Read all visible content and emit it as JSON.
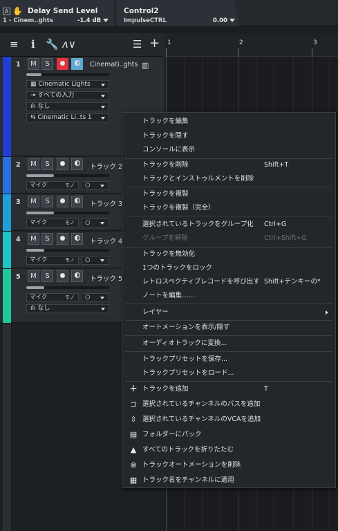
{
  "top_bar": {
    "a_label": "A",
    "param_title": "Delay Send Level",
    "param_source": "1 - Cinem..ghts",
    "param_value": "-1.4 dB",
    "control_title": "Control2",
    "control_source": "ImpulseCTRL",
    "control_value": "0.00"
  },
  "ruler": {
    "marks": [
      "1",
      "2",
      "3"
    ]
  },
  "tracks": [
    {
      "number": "1",
      "name": "Cinemati..ghts",
      "color": "#1f3fd6",
      "mute": "M",
      "solo": "S",
      "record_active": true,
      "monitor_active": true,
      "instrument": "Cinematic Lights",
      "input": "すべての入力",
      "output": "なし",
      "output2": "Cinematic Li..ts 1"
    },
    {
      "number": "2",
      "name": "トラック 2",
      "color": "#2a6ee0",
      "mute": "M",
      "solo": "S",
      "input": "マイク",
      "mono": "モノ"
    },
    {
      "number": "3",
      "name": "トラック 3",
      "color": "#1f9ed8",
      "mute": "M",
      "solo": "S",
      "input": "マイク",
      "mono": "モノ"
    },
    {
      "number": "4",
      "name": "トラック 4",
      "color": "#1fc6c6",
      "mute": "M",
      "solo": "S",
      "input": "マイク",
      "mono": "モノ"
    },
    {
      "number": "5",
      "name": "トラック 5",
      "color": "#20c79a",
      "mute": "M",
      "solo": "S",
      "input": "マイク",
      "mono": "モノ",
      "output": "なし"
    }
  ],
  "context_menu": {
    "items": [
      {
        "label": "トラックを編集"
      },
      {
        "label": "トラックを隠す"
      },
      {
        "label": "コンソールに表示"
      },
      {
        "label": "トラックを削除",
        "shortcut": "Shift+T"
      },
      {
        "label": "トラックとインストゥルメントを削除"
      },
      {
        "label": "トラックを複製"
      },
      {
        "label": "トラックを複製（完全）"
      },
      {
        "label": "選択されているトラックをグループ化",
        "shortcut": "Ctrl+G"
      },
      {
        "label": "グループを解除",
        "shortcut": "Ctrl+Shift+G",
        "disabled": true
      },
      {
        "label": "トラックを無効化"
      },
      {
        "label": "1つのトラックをロック"
      },
      {
        "label": "レトロスペクティブレコードを呼び出す",
        "shortcut": "Shift+テンキーの*"
      },
      {
        "label": "ノートを編集……"
      },
      {
        "label": "レイヤー"
      },
      {
        "label": "オートメーションを表示/隠す"
      },
      {
        "label": "オーディオトラックに変換..."
      },
      {
        "label": "トラックプリセットを保存..."
      },
      {
        "label": "トラックプリセットをロード..."
      },
      {
        "label": "トラックを追加",
        "shortcut": "T",
        "icon": "plus-icon"
      },
      {
        "label": "選択されているチャンネルのバスを追加",
        "icon": "bus-icon"
      },
      {
        "label": "選択されているチャンネルのVCAを追加",
        "icon": "vca-icon"
      },
      {
        "label": "フォルダーにパック",
        "icon": "folder-pack-icon"
      },
      {
        "label": "すべてのトラックを折りたたむ",
        "icon": "collapse-icon"
      },
      {
        "label": "トラックオートメーションを削除",
        "icon": "remove-automation-icon"
      },
      {
        "label": "トラック名をチャンネルに適用",
        "icon": "apply-name-icon"
      }
    ]
  }
}
